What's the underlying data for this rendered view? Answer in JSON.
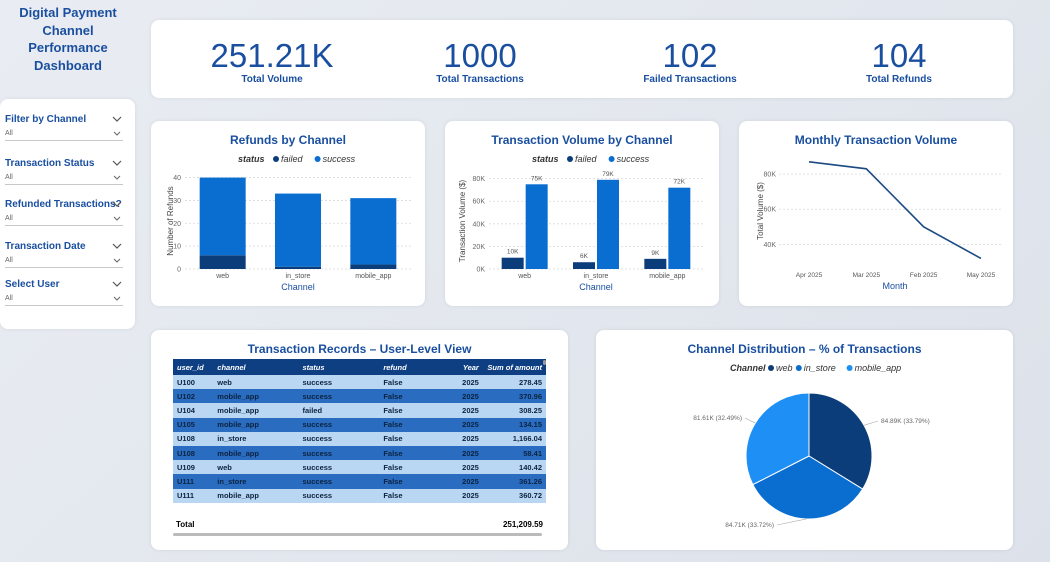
{
  "dashboard_title": "Digital Payment Channel Performance Dashboard",
  "kpis": [
    {
      "value": "251.21K",
      "label": "Total Volume"
    },
    {
      "value": "1000",
      "label": "Total Transactions"
    },
    {
      "value": "102",
      "label": "Failed Transactions"
    },
    {
      "value": "104",
      "label": "Total Refunds"
    }
  ],
  "filters": [
    {
      "label": "Filter by Channel",
      "value": "All"
    },
    {
      "label": "Transaction Status",
      "value": "All"
    },
    {
      "label": "Refunded Transactions?",
      "value": "All"
    },
    {
      "label": "Transaction Date",
      "value": "All"
    },
    {
      "label": "Select User",
      "value": "All"
    }
  ],
  "colors": {
    "failed": "#0b3d7a",
    "success": "#0a6ed1",
    "line": "#1c4a82",
    "title": "#1a4fa0"
  },
  "chart_data": [
    {
      "type": "bar",
      "title": "Refunds by Channel",
      "legend_title": "status",
      "legend": [
        "failed",
        "success"
      ],
      "categories": [
        "web",
        "in_store",
        "mobile_app"
      ],
      "series": [
        {
          "name": "failed",
          "values": [
            6,
            1,
            2
          ]
        },
        {
          "name": "success",
          "values": [
            34,
            32,
            29
          ]
        }
      ],
      "stacked": true,
      "xlabel": "Channel",
      "ylabel": "Number of Refunds",
      "yticks": [
        "0",
        "10",
        "20",
        "30",
        "40"
      ],
      "ylim": [
        0,
        42
      ]
    },
    {
      "type": "bar",
      "title": "Transaction Volume by Channel",
      "legend_title": "status",
      "legend": [
        "failed",
        "success"
      ],
      "categories": [
        "web",
        "in_store",
        "mobile_app"
      ],
      "series": [
        {
          "name": "failed",
          "values": [
            10,
            6,
            9
          ],
          "labels": [
            "10K",
            "6K",
            "9K"
          ]
        },
        {
          "name": "success",
          "values": [
            75,
            79,
            72
          ],
          "labels": [
            "75K",
            "79K",
            "72K"
          ]
        }
      ],
      "stacked": false,
      "xlabel": "Channel",
      "ylabel": "Transaction Volume ($)",
      "yticks": [
        "0K",
        "20K",
        "40K",
        "60K",
        "80K"
      ],
      "ylim": [
        0,
        85
      ]
    },
    {
      "type": "line",
      "title": "Monthly Transaction Volume",
      "x": [
        "Apr 2025",
        "Mar 2025",
        "Feb 2025",
        "May 2025"
      ],
      "values": [
        87,
        83,
        50,
        32
      ],
      "xlabel": "Month",
      "ylabel": "Total Volume ($)",
      "yticks": [
        "40K",
        "60K",
        "80K"
      ],
      "ylim": [
        26,
        92
      ]
    },
    {
      "type": "pie",
      "title": "Channel Distribution – % of Transactions",
      "legend_title": "Channel",
      "legend": [
        "web",
        "in_store",
        "mobile_app"
      ],
      "slices": [
        {
          "name": "web",
          "value": 84.89,
          "label": "84.89K (33.79%)",
          "color": "#0b3d7a"
        },
        {
          "name": "in_store",
          "value": 84.71,
          "label": "84.71K (33.72%)",
          "color": "#0a6ed1"
        },
        {
          "name": "mobile_app",
          "value": 81.61,
          "label": "81.61K (32.49%)",
          "color": "#1e8ff5"
        }
      ]
    },
    {
      "type": "table",
      "title": "Transaction Records – User-Level View",
      "columns": [
        "user_id",
        "channel",
        "status",
        "refund",
        "Year",
        "Sum of amount"
      ],
      "rows": [
        [
          "U100",
          "web",
          "success",
          "False",
          "2025",
          "278.45"
        ],
        [
          "U102",
          "mobile_app",
          "success",
          "False",
          "2025",
          "370.96"
        ],
        [
          "U104",
          "mobile_app",
          "failed",
          "False",
          "2025",
          "308.25"
        ],
        [
          "U105",
          "mobile_app",
          "success",
          "False",
          "2025",
          "134.15"
        ],
        [
          "U108",
          "in_store",
          "success",
          "False",
          "2025",
          "1,166.04"
        ],
        [
          "U108",
          "mobile_app",
          "success",
          "False",
          "2025",
          "58.41"
        ],
        [
          "U109",
          "web",
          "success",
          "False",
          "2025",
          "140.42"
        ],
        [
          "U111",
          "in_store",
          "success",
          "False",
          "2025",
          "361.26"
        ],
        [
          "U111",
          "mobile_app",
          "success",
          "False",
          "2025",
          "360.72"
        ]
      ],
      "total_label": "Total",
      "total_value": "251,209.59"
    }
  ]
}
